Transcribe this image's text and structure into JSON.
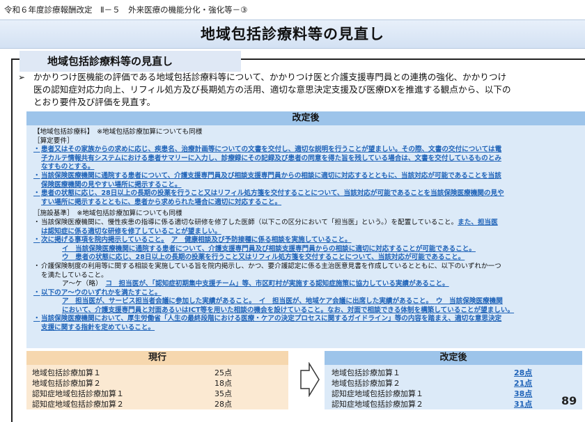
{
  "breadcrumb": "令和６年度診療報酬改定　Ⅱ－５　外来医療の機能分化・強化等－③",
  "title": "地域包括診療料等の見直し",
  "section_heading": "地域包括診療料等の見直し",
  "intro": {
    "bullet": "➢",
    "line1": "かかりつけ医機能の評価である地域包括診療料等について、かかりつけ医と介護支援専門員との連携の強化、かかりつけ",
    "line2": "医の認知症対応力向上、リフィル処方及び長期処方の活用、適切な意思決定支援及び医療DXを推進する観点から、以下の",
    "line3": "とおり要件及び評価を見直す。"
  },
  "kaitei": {
    "header": "改定後",
    "l1": "【地域包括診療料】　※地域包括診療加算についても同様",
    "l2": "［算定要件］",
    "bullet": "・",
    "a1": "患者又はその家族からの求めに応じ、疾患名、治療計画等についての文書を交付し、適切な説明を行うことが望ましい。その際、文書の交付については電",
    "a2": "子カルテ情報共有システムにおける患者サマリーに入力し、診療録にその記録及び患者の同意を得た旨を残している場合は、文書を交付しているものとみ",
    "a3": "なすものとする。",
    "b1": "当該保険医療機関に通院する患者について、介護支援専門員及び相談支援専門員からの相談に適切に対応するとともに、当該対応が可能であることを当該",
    "b2": "保険医療機関の見やすい場所に掲示すること。",
    "c1": "患者の状態に応じ、28日以上の長期の投薬を行うこと又はリフィル処方箋を交付することについて、当該対応が可能であることを当該保険医療機関の見や",
    "c2": "すい場所に掲示するとともに、患者から求められた場合に適切に対応すること。",
    "l3": "［施設基準］　※地域包括診療加算についても同様",
    "d1a": "当該保険医療機関に、慢性疾患の指導に係る適切な研修を修了した医師（以下この区分において「担当医」という。）を配置していること。",
    "d1b": "また、担当医",
    "d2": "は認知症に係る適切な研修を修了していることが望ましい。",
    "e1a": "次に掲げる事項を院内掲示していること。",
    "e1b": "ア　健康相談及び予防接種に係る相談を実施していること。",
    "e2": "イ　当該保険医療機関に通院する患者について、介護支援専門員及び相談支援専門員からの相談に適切に対応することが可能であること。",
    "e3": "ウ　患者の状態に応じ、28日以上の長期の投薬を行うこと又はリフィル処方箋を交付することについて、当該対応が可能であること。",
    "f1": "介護保険制度の利用等に関する相談を実施している旨を院内掲示し、かつ、要介護認定に係る主治医意見書を作成しているとともに、以下のいずれか一つ",
    "f2": "を満たしていること。",
    "f3a": "ア～ケ（略）",
    "f3b": "コ　担当医が、「認知症初期集中支援チーム」等、市区町村が実施する認知症施策に協力している実績があること。",
    "g1": "以下のア～ウのいずれかを満たすこと。",
    "g2": "ア　担当医が、サービス担当者会議に参加した実績があること。　イ　担当医が、地域ケア会議に出席した実績があること。　ウ　当該保険医療機関",
    "g3": "において、介護支援専門員と対面あるいはICT等を用いた相談の機会を設けていること。なお、対面で相談できる体制を構築していることが望ましい。",
    "h1": "当該保険医療機関において、厚生労働省「人生の最終段階における医療・ケアの決定プロセスに関するガイドライン」等の内容を踏まえ、適切な意思決定",
    "h2": "支援に関する指針を定めていること。"
  },
  "genkou": {
    "header": "現行",
    "rows": [
      {
        "label": "地域包括診療加算１",
        "value": "25点"
      },
      {
        "label": "地域包括診療加算２",
        "value": "18点"
      },
      {
        "label": "認知症地域包括診療加算１",
        "value": "35点"
      },
      {
        "label": "認知症地域包括診療加算２",
        "value": "28点"
      }
    ]
  },
  "kaitei_score": {
    "header": "改定後",
    "rows": [
      {
        "label": "地域包括診療加算１",
        "value": "28点"
      },
      {
        "label": "地域包括診療加算２",
        "value": "21点"
      },
      {
        "label": "認知症地域包括診療加算１",
        "value": "38点"
      },
      {
        "label": "認知症地域包括診療加算２",
        "value": "31点"
      }
    ]
  },
  "page_number": "89",
  "colors": {
    "accent_blue": "#1f63b8",
    "kaitei_header": "#9dc4ea",
    "genkou_header": "#f6d7ae"
  }
}
